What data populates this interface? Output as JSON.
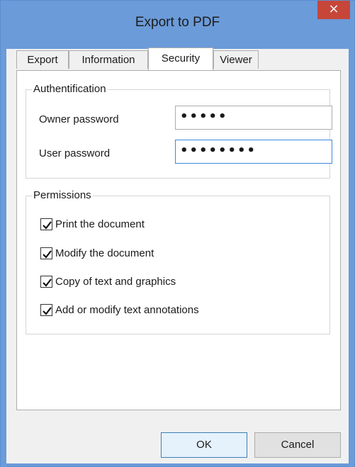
{
  "window": {
    "title": "Export to PDF",
    "close_symbol": "×"
  },
  "tabs": [
    {
      "label": "Export",
      "active": false
    },
    {
      "label": "Information",
      "active": false
    },
    {
      "label": "Security",
      "active": true
    },
    {
      "label": "Viewer",
      "active": false
    }
  ],
  "authentication": {
    "group_label": "Authentification",
    "owner_password": {
      "label": "Owner password",
      "value": "•••••"
    },
    "user_password": {
      "label": "User password",
      "value": "••••••••"
    }
  },
  "permissions": {
    "group_label": "Permissions",
    "items": [
      {
        "label": "Print the document",
        "checked": true
      },
      {
        "label": "Modify the document",
        "checked": true
      },
      {
        "label": "Copy of text and graphics",
        "checked": true
      },
      {
        "label": "Add or modify text annotations",
        "checked": true
      }
    ]
  },
  "buttons": {
    "ok_label": "OK",
    "cancel_label": "Cancel"
  },
  "colors": {
    "title_bar": "#6b9bd9",
    "close_button": "#c7463a",
    "focus_border": "#3b8ad9"
  }
}
